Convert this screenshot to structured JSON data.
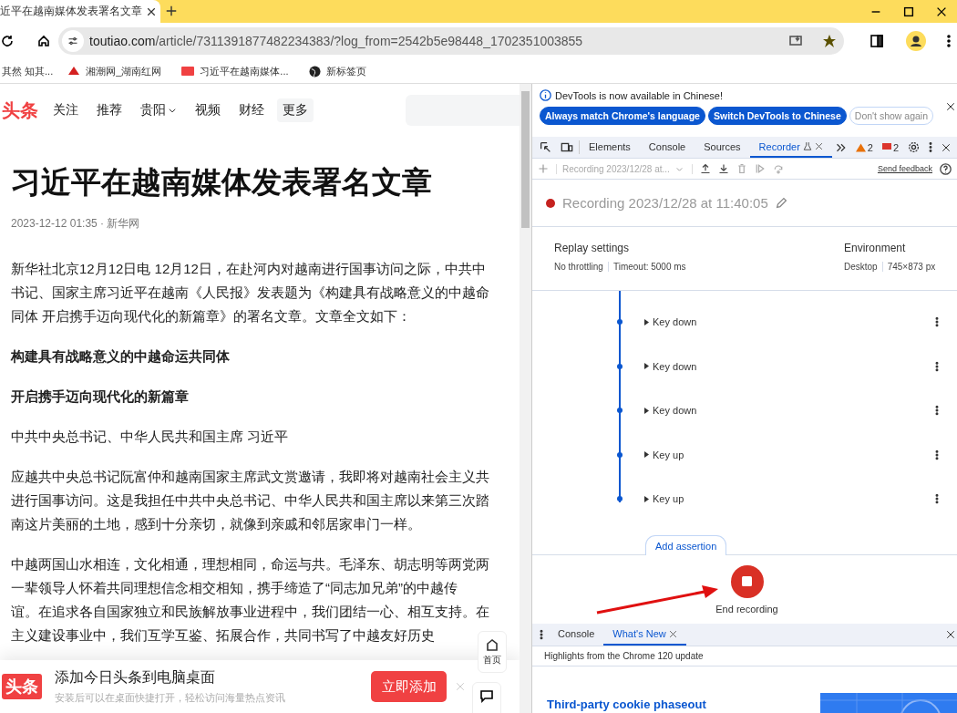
{
  "browser": {
    "tab": {
      "title": "近平在越南媒体发表署名文章",
      "selected": true
    },
    "url": {
      "host": "toutiao.com",
      "path": "/article/7311391877482234383/?log_from=2542b5e98448_1702351003855"
    },
    "bookmarks": [
      {
        "label": "其然 知其...",
        "kind": "text"
      },
      {
        "label": "湘潮网_湖南红网",
        "kind": "brand"
      },
      {
        "label": "习近平在越南媒体...",
        "kind": "news"
      },
      {
        "label": "新标签页",
        "kind": "globe"
      }
    ]
  },
  "page": {
    "logo": "头条",
    "nav": [
      {
        "label": "关注",
        "dropdown": false,
        "selected": false
      },
      {
        "label": "推荐",
        "dropdown": false,
        "selected": false
      },
      {
        "label": "贵阳",
        "dropdown": true,
        "selected": false
      },
      {
        "label": "视频",
        "dropdown": false,
        "selected": false
      },
      {
        "label": "财经",
        "dropdown": false,
        "selected": false
      },
      {
        "label": "更多",
        "dropdown": false,
        "selected": true
      }
    ],
    "title": "习近平在越南媒体发表署名文章",
    "meta": "2023-12-12 01:35 · 新华网",
    "paragraphs": [
      {
        "kind": "text",
        "lines": [
          "新华社北京12月12日电 12月12日，在赴河内对越南进行国事访问之际，中共中",
          "书记、国家主席习近平在越南《人民报》发表题为《构建具有战略意义的中越命",
          "同体 开启携手迈向现代化的新篇章》的署名文章。文章全文如下："
        ]
      },
      {
        "kind": "heading",
        "lines": [
          "构建具有战略意义的中越命运共同体"
        ]
      },
      {
        "kind": "heading",
        "lines": [
          "开启携手迈向现代化的新篇章"
        ]
      },
      {
        "kind": "text",
        "lines": [
          "中共中央总书记、中华人民共和国主席 习近平"
        ]
      },
      {
        "kind": "text",
        "lines": [
          "应越共中央总书记阮富仲和越南国家主席武文赏邀请，我即将对越南社会主义共",
          "进行国事访问。这是我担任中共中央总书记、中华人民共和国主席以来第三次踏",
          "南这片美丽的土地，感到十分亲切，就像到亲戚和邻居家串门一样。"
        ]
      },
      {
        "kind": "text",
        "lines": [
          "中越两国山水相连，文化相通，理想相同，命运与共。毛泽东、胡志明等两党两",
          "一辈领导人怀着共同理想信念相交相知，携手缔造了“同志加兄弟”的中越传",
          "谊。在追求各自国家独立和民族解放事业进程中，我们团结一心、相互支持。在",
          "主义建设事业中，我们互学互鉴、拓展合作，共同书写了中越友好历史"
        ]
      }
    ],
    "float_home": "首页",
    "banner": {
      "logo": "头条",
      "title": "添加今日头条到电脑桌面",
      "subtitle": "安装后可以在桌面快捷打开，轻松访问海量热点资讯",
      "button": "立即添加"
    }
  },
  "devtools": {
    "infobar": {
      "message": "DevTools is now available in Chinese!",
      "buttons": [
        {
          "label": "Always match Chrome's language",
          "primary": true
        },
        {
          "label": "Switch DevTools to Chinese",
          "primary": true
        },
        {
          "label": "Don't show again",
          "primary": false
        }
      ]
    },
    "tabs": [
      {
        "label": "Elements",
        "selected": false
      },
      {
        "label": "Console",
        "selected": false
      },
      {
        "label": "Sources",
        "selected": false
      },
      {
        "label": "Recorder",
        "selected": true
      }
    ],
    "warnings": "2",
    "errors": "2",
    "recording_select": "Recording 2023/12/28 at...",
    "feedback": "Send feedback",
    "recording_title": "Recording 2023/12/28 at 11:40:05",
    "replay": {
      "label": "Replay settings",
      "values": [
        "No throttling",
        "Timeout: 5000 ms"
      ]
    },
    "environment": {
      "label": "Environment",
      "values": [
        "Desktop",
        "745×873 px"
      ]
    },
    "steps": [
      "Key down",
      "Key down",
      "Key down",
      "Key up",
      "Key up"
    ],
    "add_assertion": "Add assertion",
    "end_recording": "End recording",
    "drawer_tabs": [
      {
        "label": "Console",
        "selected": false,
        "closable": false
      },
      {
        "label": "What's New",
        "selected": true,
        "closable": true
      }
    ],
    "highlights": "Highlights from the Chrome 120 update",
    "article_title": "Third-party cookie phaseout"
  }
}
